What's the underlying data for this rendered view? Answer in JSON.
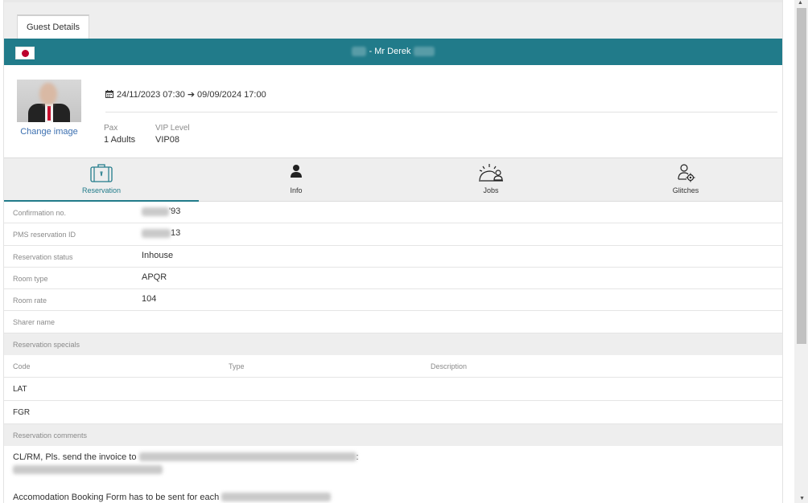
{
  "tabs": [
    {
      "label": "Guest Details"
    }
  ],
  "guest": {
    "separator": "-",
    "name": "Mr Derek",
    "flag": "japan-flag"
  },
  "profile": {
    "change_image": "Change image",
    "arrival": "24/11/2023 07:30",
    "departure": "09/09/2024 17:00",
    "pax_label": "Pax",
    "pax_value": "1 Adults",
    "vip_label": "VIP Level",
    "vip_value": "VIP08"
  },
  "nav": [
    {
      "label": "Reservation",
      "icon": "suitcase-icon",
      "active": true
    },
    {
      "label": "Info",
      "icon": "person-icon",
      "active": false
    },
    {
      "label": "Jobs",
      "icon": "sunrise-person-icon",
      "active": false
    },
    {
      "label": "Glitches",
      "icon": "person-gear-icon",
      "active": false
    }
  ],
  "details": [
    {
      "label": "Confirmation no.",
      "value": "'93"
    },
    {
      "label": "PMS reservation ID",
      "value": "13"
    },
    {
      "label": "Reservation status",
      "value": "Inhouse"
    },
    {
      "label": "Room type",
      "value": "APQR"
    },
    {
      "label": "Room rate",
      "value": "104"
    },
    {
      "label": "Sharer name",
      "value": ""
    }
  ],
  "specials": {
    "title": "Reservation specials",
    "headers": [
      "Code",
      "Type",
      "Description"
    ],
    "rows": [
      {
        "code": "LAT"
      },
      {
        "code": "FGR"
      }
    ]
  },
  "comments": {
    "title": "Reservation comments",
    "line1_prefix": "CL/RM, Pls. send the invoice to",
    "line1_suffix": ":",
    "line2_prefix": "Accomodation Booking Form has to be sent for each"
  },
  "colors": {
    "accent": "#217b8a",
    "link": "#3b6fb0",
    "flag_red": "#bc002d"
  }
}
